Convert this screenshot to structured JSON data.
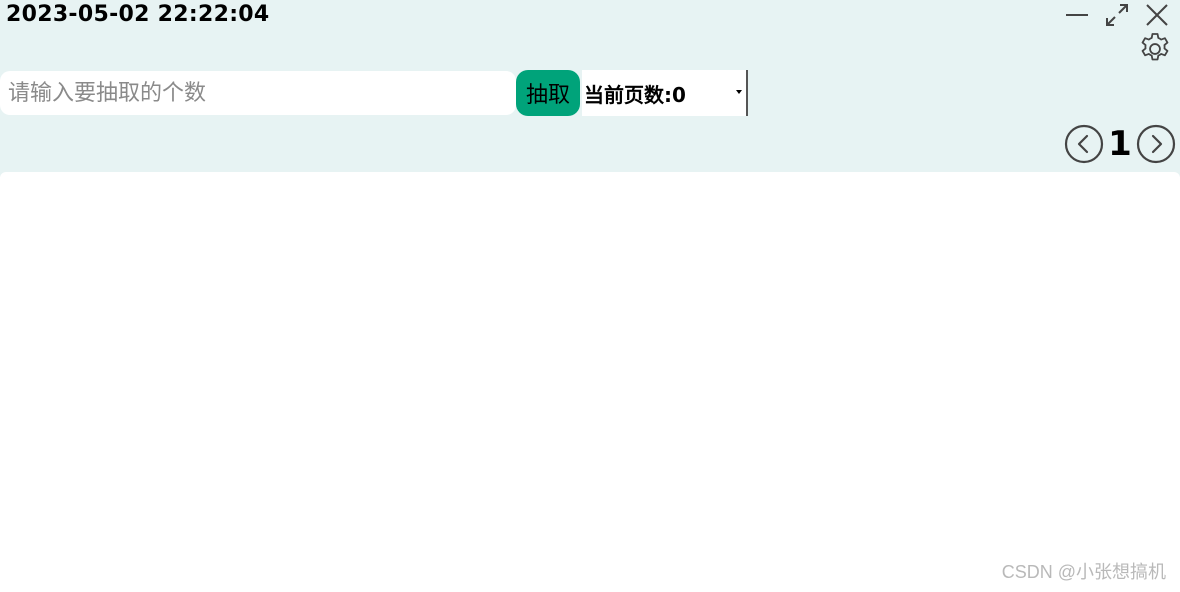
{
  "header": {
    "timestamp": "2023-05-02 22:22:04"
  },
  "window_controls": {
    "minimize_icon": "minimize-icon",
    "maximize_icon": "maximize-icon",
    "close_icon": "close-icon",
    "settings_icon": "gear-icon"
  },
  "toolbar": {
    "count_input": {
      "value": "",
      "placeholder": "请输入要抽取的个数"
    },
    "extract_label": "抽取",
    "page_select_label": "当前页数:0"
  },
  "pager": {
    "current_page": "1",
    "prev_icon": "chevron-left-circle-icon",
    "next_icon": "chevron-right-circle-icon"
  },
  "watermark": "CSDN @小张想搞机",
  "colors": {
    "background": "#e7f3f3",
    "accent": "#00a37a",
    "content_bg": "#ffffff"
  }
}
